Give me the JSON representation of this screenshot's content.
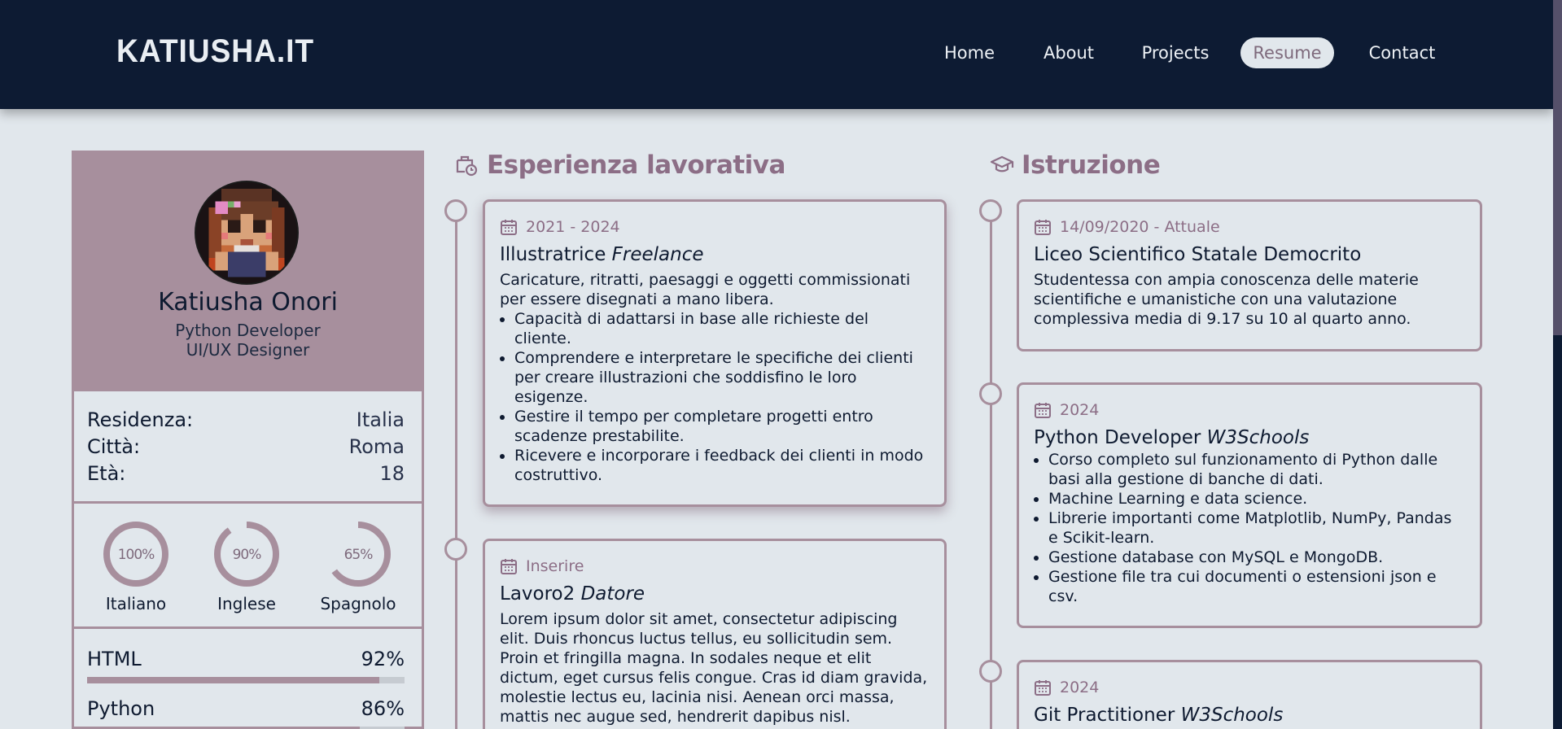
{
  "header": {
    "logo": "KATIUSHA.IT",
    "nav": [
      {
        "label": "Home",
        "active": false
      },
      {
        "label": "About",
        "active": false
      },
      {
        "label": "Projects",
        "active": false
      },
      {
        "label": "Resume",
        "active": true
      },
      {
        "label": "Contact",
        "active": false
      }
    ]
  },
  "profile": {
    "name": "Katiusha Onori",
    "roles": [
      "Python Developer",
      "UI/UX Designer"
    ],
    "info": [
      {
        "label": "Residenza:",
        "value": "Italia"
      },
      {
        "label": "Città:",
        "value": "Roma"
      },
      {
        "label": "Età:",
        "value": "18"
      }
    ],
    "languages": [
      {
        "name": "Italiano",
        "percent": 100,
        "percent_label": "100%"
      },
      {
        "name": "Inglese",
        "percent": 90,
        "percent_label": "90%"
      },
      {
        "name": "Spagnolo",
        "percent": 65,
        "percent_label": "65%"
      }
    ],
    "skills": [
      {
        "name": "HTML",
        "percent": 92,
        "percent_label": "92%"
      },
      {
        "name": "Python",
        "percent": 86,
        "percent_label": "86%"
      }
    ]
  },
  "experience": {
    "title": "Esperienza lavorativa",
    "icon": "briefcase-clock-icon",
    "items": [
      {
        "date": "2021 - 2024",
        "role": "Illustratrice",
        "org": "Freelance",
        "desc": "Caricature, ritratti, paesaggi e oggetti commissionati per essere disegnati a mano libera.",
        "bullets": [
          "Capacità di adattarsi in base alle richieste del cliente.",
          "Comprendere e interpretare le specifiche dei clienti per creare illustrazioni che soddisfino le loro esigenze.",
          "Gestire il tempo per completare progetti entro scadenze prestabilite.",
          "Ricevere e incorporare i feedback dei clienti in modo costruttivo."
        ]
      },
      {
        "date": "Inserire",
        "role": "Lavoro2",
        "org": "Datore",
        "desc": "Lorem ipsum dolor sit amet, consectetur adipiscing elit. Duis rhoncus luctus tellus, eu sollicitudin sem. Proin et fringilla magna. In sodales neque et elit dictum, eget cursus felis congue. Cras id diam gravida, molestie lectus eu, lacinia nisi. Aenean orci massa, mattis nec augue sed, hendrerit dapibus nisl.",
        "bullets": []
      }
    ]
  },
  "education": {
    "title": "Istruzione",
    "icon": "graduation-cap-icon",
    "items": [
      {
        "date": "14/09/2020 - Attuale",
        "role": "Liceo Scientifico Statale Democrito",
        "org": "",
        "desc": "Studentessa con ampia conoscenza delle materie scientifiche e umanistiche con una valutazione complessiva media di 9.17 su 10 al quarto anno.",
        "bullets": []
      },
      {
        "date": "2024",
        "role": "Python Developer",
        "org": "W3Schools",
        "desc": "",
        "bullets": [
          "Corso completo sul funzionamento di Python dalle basi alla gestione di banche di dati.",
          "Machine Learning e data science.",
          "Librerie importanti come Matplotlib, NumPy, Pandas e Scikit-learn.",
          "Gestione database con MySQL e MongoDB.",
          "Gestione file tra cui documenti o estensioni json e csv."
        ]
      },
      {
        "date": "2024",
        "role": "Git Practitioner",
        "org": "W3Schools",
        "desc": "",
        "bullets": []
      }
    ]
  },
  "colors": {
    "navy": "#0d1b33",
    "mauve": "#a78f9d",
    "accent_text": "#8c6e86",
    "background": "#e1e7ec"
  }
}
